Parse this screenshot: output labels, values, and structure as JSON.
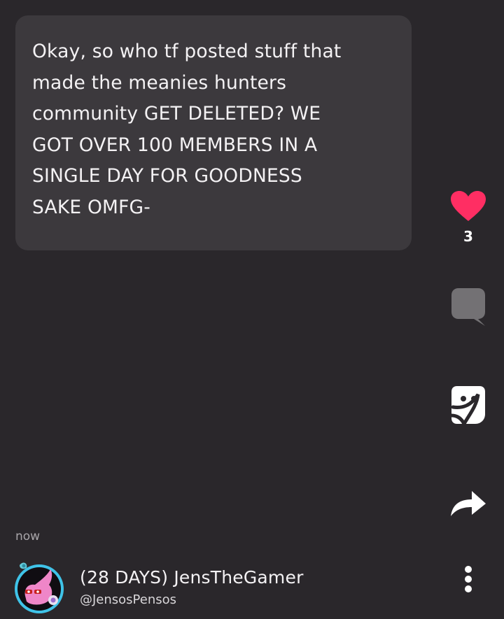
{
  "post": {
    "text": "Okay, so who tf posted stuff that\nmade the meanies hunters\ncommunity GET DELETED? WE\nGOT OVER 100 MEMBERS IN A\nSINGLE DAY FOR GOODNESS\nSAKE OMFG-",
    "timestamp": "now"
  },
  "actions": {
    "like_count": "3",
    "like_icon": "heart-icon",
    "comment_icon": "comment-bubble-icon",
    "sticker_icon": "sticker-icon",
    "share_icon": "share-arrow-icon",
    "more_icon": "more-vertical-icon"
  },
  "author": {
    "name": "(28 DAYS) JensTheGamer",
    "handle": "@JensosPensos"
  },
  "colors": {
    "background": "#2a272b",
    "bubble": "#3c393d",
    "heart": "#ff2e63",
    "avatar_ring": "#3fc3e8"
  }
}
